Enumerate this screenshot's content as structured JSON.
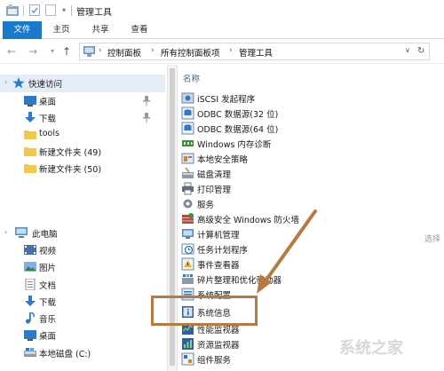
{
  "window": {
    "title": "管理工具"
  },
  "ribbon": {
    "tabs": [
      "文件",
      "主页",
      "共享",
      "查看"
    ]
  },
  "address": {
    "crumbs": [
      "控制面板",
      "所有控制面板项",
      "管理工具"
    ]
  },
  "sidebar": {
    "quick_access": {
      "label": "快速访问",
      "items": [
        "桌面",
        "下载",
        "tools",
        "新建文件夹 (49)",
        "新建文件夹 (50)"
      ]
    },
    "this_pc": {
      "label": "此电脑",
      "items": [
        "视频",
        "图片",
        "文档",
        "下载",
        "音乐",
        "桌面",
        "本地磁盘 (C:)"
      ]
    }
  },
  "list": {
    "column_header": "名称",
    "items": [
      "iSCSI 发起程序",
      "ODBC 数据源(32 位)",
      "ODBC 数据源(64 位)",
      "Windows 内存诊断",
      "本地安全策略",
      "磁盘清理",
      "打印管理",
      "服务",
      "高级安全 Windows 防火墙",
      "计算机管理",
      "任务计划程序",
      "事件查看器",
      "碎片整理和优化驱动器",
      "系统配置",
      "系统信息",
      "性能监视器",
      "资源监视器",
      "组件服务"
    ],
    "highlighted": "系统信息"
  },
  "right_pane": {
    "cut_text": "选择"
  },
  "watermark": "系统之家",
  "colors": {
    "file_tab": "#1979ca",
    "annotation": "#b67a45",
    "folder": "#f2c94c",
    "blue_icon": "#2f79c9"
  }
}
